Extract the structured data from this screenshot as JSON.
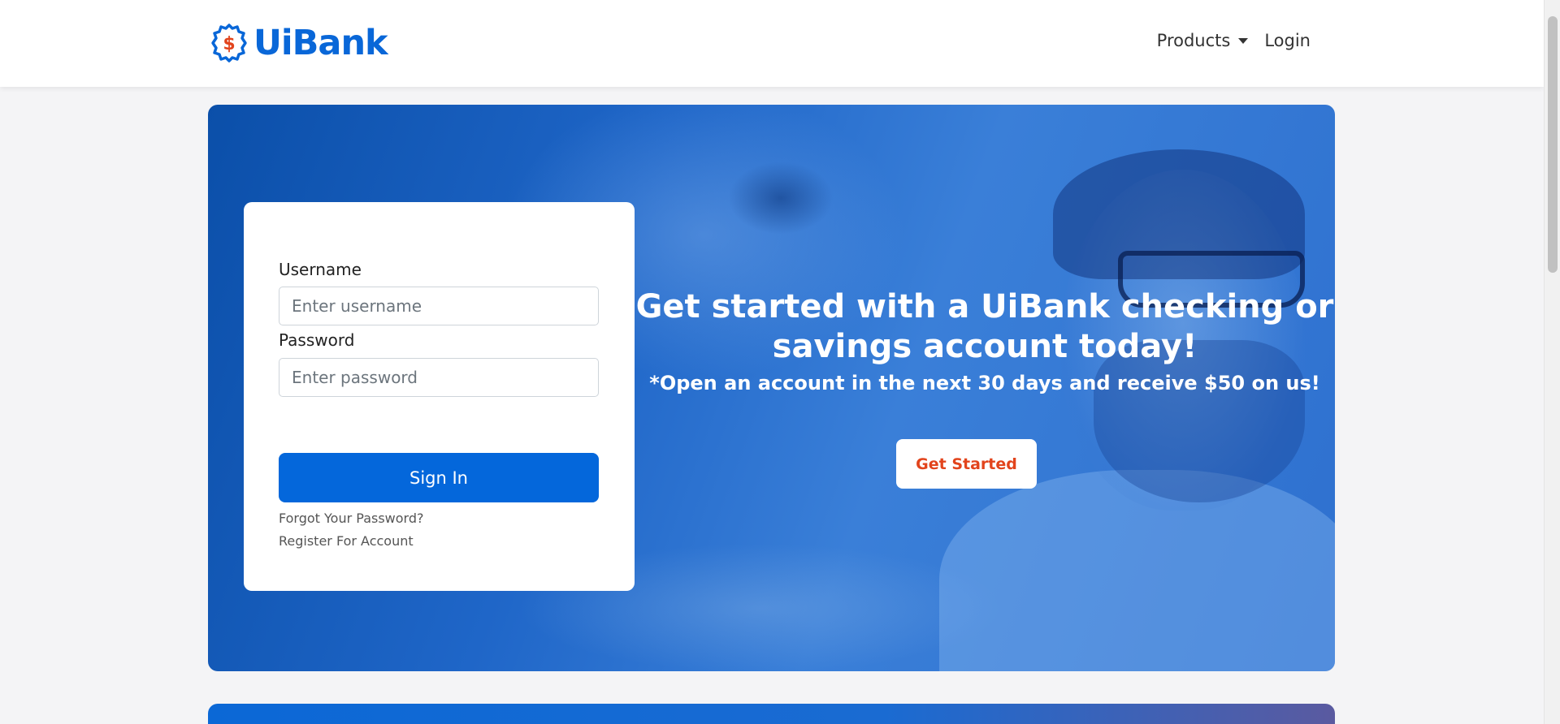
{
  "header": {
    "brand_name": "UiBank",
    "nav": {
      "products_label": "Products",
      "login_label": "Login"
    }
  },
  "login": {
    "username_label": "Username",
    "username_placeholder": "Enter username",
    "password_label": "Password",
    "password_placeholder": "Enter password",
    "signin_label": "Sign In",
    "forgot_label": "Forgot Your Password?",
    "register_label": "Register For Account"
  },
  "hero": {
    "title": "Get started with a UiBank checking or savings account today!",
    "subtitle": "*Open an account in the next 30 days and receive $50 on us!",
    "cta_label": "Get Started"
  },
  "colors": {
    "brand_blue": "#0967d8",
    "accent_orange": "#e2441c",
    "hero_blue": "#1f66c8"
  },
  "icons": {
    "logo": "dollar-badge-icon",
    "products_caret": "caret-down-icon"
  }
}
